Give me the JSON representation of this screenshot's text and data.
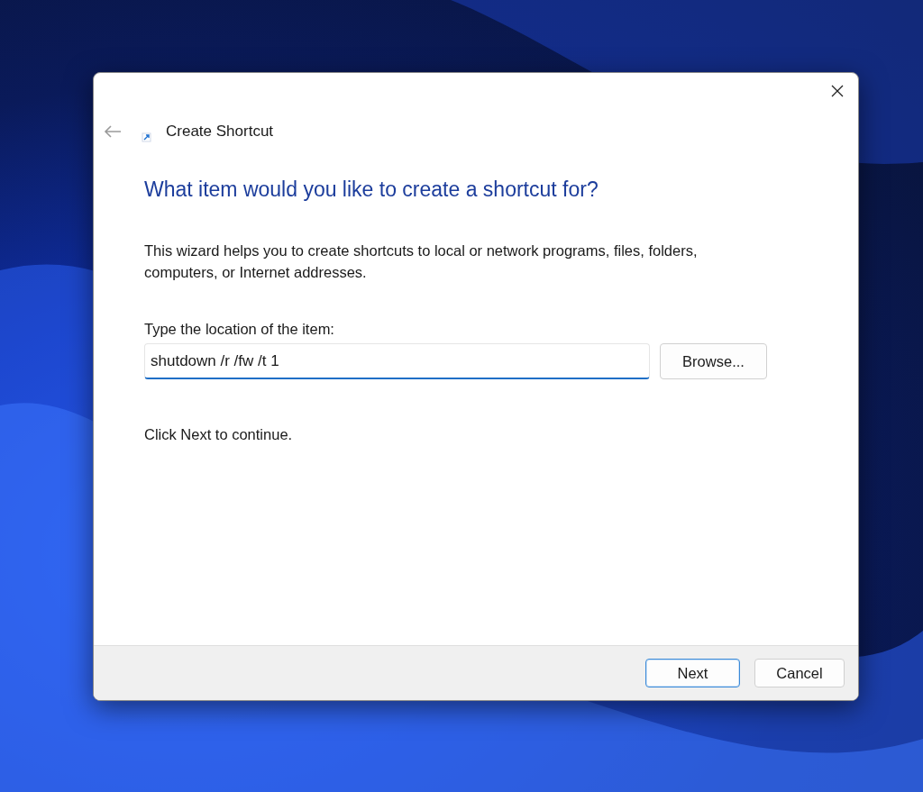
{
  "window": {
    "title": "Create Shortcut"
  },
  "heading": "What item would you like to create a shortcut for?",
  "description": "This wizard helps you to create shortcuts to local or network programs, files, folders, computers, or Internet addresses.",
  "location": {
    "label": "Type the location of the item:",
    "value": "shutdown /r /fw /t 1",
    "browse_button": "Browse..."
  },
  "hint": "Click Next to continue.",
  "buttons": [
    {
      "label": "Next",
      "default": true
    },
    {
      "label": "Cancel",
      "default": false
    }
  ]
}
